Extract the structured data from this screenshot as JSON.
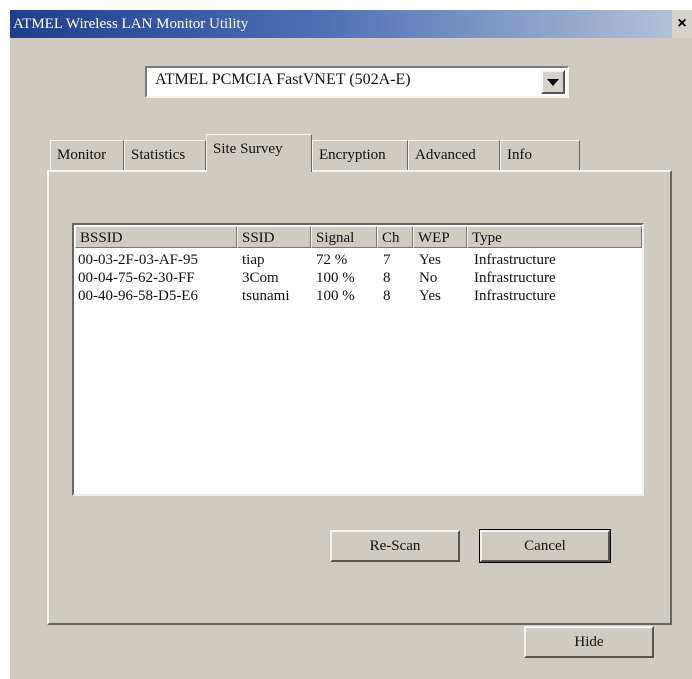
{
  "window": {
    "title": "ATMEL Wireless LAN Monitor Utility",
    "close_glyph": "×"
  },
  "adapter": {
    "selected": "ATMEL PCMCIA FastVNET (502A-E)"
  },
  "tabs": [
    {
      "label": "Monitor"
    },
    {
      "label": "Statistics"
    },
    {
      "label": "Site Survey"
    },
    {
      "label": "Encryption"
    },
    {
      "label": "Advanced"
    },
    {
      "label": "Info"
    }
  ],
  "survey": {
    "columns": [
      "BSSID",
      "SSID",
      "Signal",
      "Ch",
      "WEP",
      "Type"
    ],
    "rows": [
      [
        "00-03-2F-03-AF-95",
        "tiap",
        "72 %",
        "7",
        "Yes",
        "Infrastructure"
      ],
      [
        "00-04-75-62-30-FF",
        "3Com",
        "100 %",
        "8",
        "No",
        "Infrastructure"
      ],
      [
        "00-40-96-58-D5-E6",
        "tsunami",
        "100 %",
        "8",
        "Yes",
        "Infrastructure"
      ]
    ]
  },
  "buttons": {
    "rescan": "Re-Scan",
    "cancel": "Cancel",
    "hide": "Hide"
  }
}
